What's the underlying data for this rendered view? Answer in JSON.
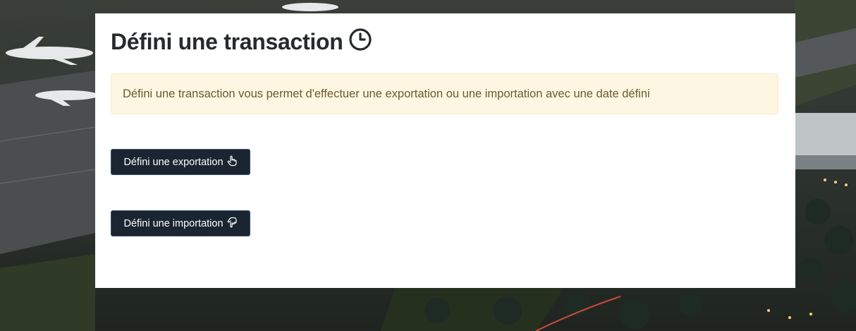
{
  "page": {
    "title": "Défini une transaction",
    "title_icon": "clock-icon"
  },
  "alert": {
    "text": "Défini une transaction vous permet d'effectuer une exportation ou une importation avec une date défini"
  },
  "buttons": {
    "export_label": "Défini une exportation",
    "export_icon": "hand-point-up-icon",
    "import_label": "Défini une importation",
    "import_icon": "hand-point-down-icon"
  },
  "colors": {
    "button_bg": "#1b2532",
    "alert_bg": "#fdf6e3",
    "alert_text": "#6e5a2b",
    "title_text": "#262a2e"
  }
}
